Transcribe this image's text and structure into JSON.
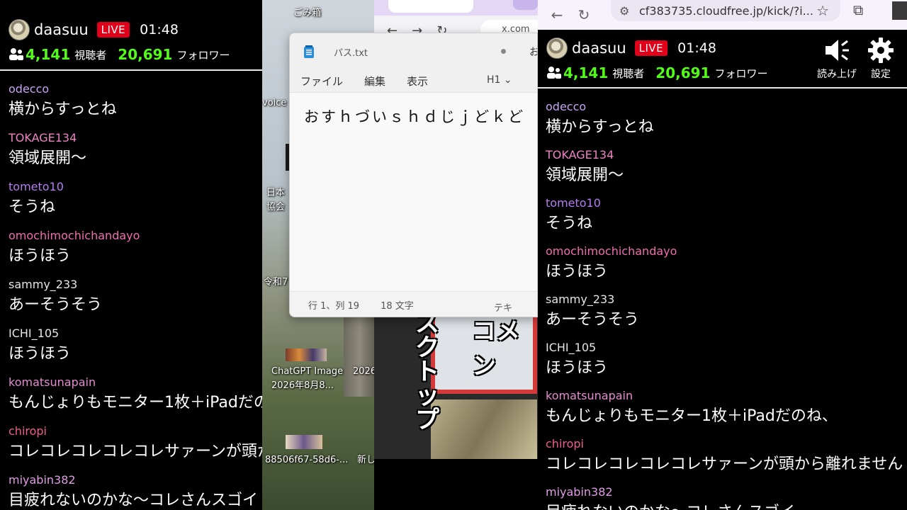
{
  "chat": {
    "streamer": "daasuu",
    "live_label": "LIVE",
    "time": "01:48",
    "viewers": "4,141",
    "viewers_unit": "視聴者",
    "followers": "20,691",
    "followers_unit": "フォロワー",
    "read_aloud_label": "読み上げ",
    "settings_label": "設定",
    "messages": [
      {
        "user": "odecco",
        "color": "#c7a4f5",
        "text": "横からすっとね"
      },
      {
        "user": "TOKAGE134",
        "color": "#ee83c4",
        "text": "領域展開〜"
      },
      {
        "user": "tometo10",
        "color": "#b57cf0",
        "text": "そうね"
      },
      {
        "user": "omochimochichandayo",
        "color": "#f06bb0",
        "text": "ほうほう"
      },
      {
        "user": "sammy_233",
        "color": "#e6e6e6",
        "text": "あーそうそう"
      },
      {
        "user": "ICHI_105",
        "color": "#e6e6e6",
        "text": "ほうほう"
      },
      {
        "user": "komatsunapain",
        "color": "#e58bd0",
        "text": "もんじょりもモニター1枚＋iPadだのね、"
      },
      {
        "user": "chiropi",
        "color": "#f05b90",
        "text": "コレコレコレコレコレサァーンが頭から離れません"
      },
      {
        "user": "miyabin382",
        "color": "#e19ce6",
        "text": "目疲れないのかな〜コレさんスゴイ"
      }
    ]
  },
  "desktop": {
    "recycle_bin": "ごみ箱",
    "voice_label": "voice",
    "icon_jp_1": "日本",
    "icon_jp_2": "協会",
    "reiwa_label": "令和7",
    "chatgpt_label_1": "ChatGPT Image",
    "chatgpt_label_2": "2026年8月8...",
    "year_label": "2026",
    "file_label": "88506f67-58d6-...",
    "new_label": "新し"
  },
  "bg_browser": {
    "url_fragment": "x.com"
  },
  "video": {
    "text_top": "コメン",
    "text_vertical": "スクトップ"
  },
  "notepad": {
    "tab_title": "パス.txt",
    "tab_extra": "お",
    "menu_file": "ファイル",
    "menu_edit": "編集",
    "menu_view": "表示",
    "heading_select": "H1",
    "content": "おすｈづいｓｈｄじｊどｋど",
    "status_position": "行 1、列 19",
    "status_chars": "18 文字",
    "status_format": "テキスト"
  },
  "browser": {
    "url": "cf383735.cloudfree.jp/kick/?i..."
  }
}
